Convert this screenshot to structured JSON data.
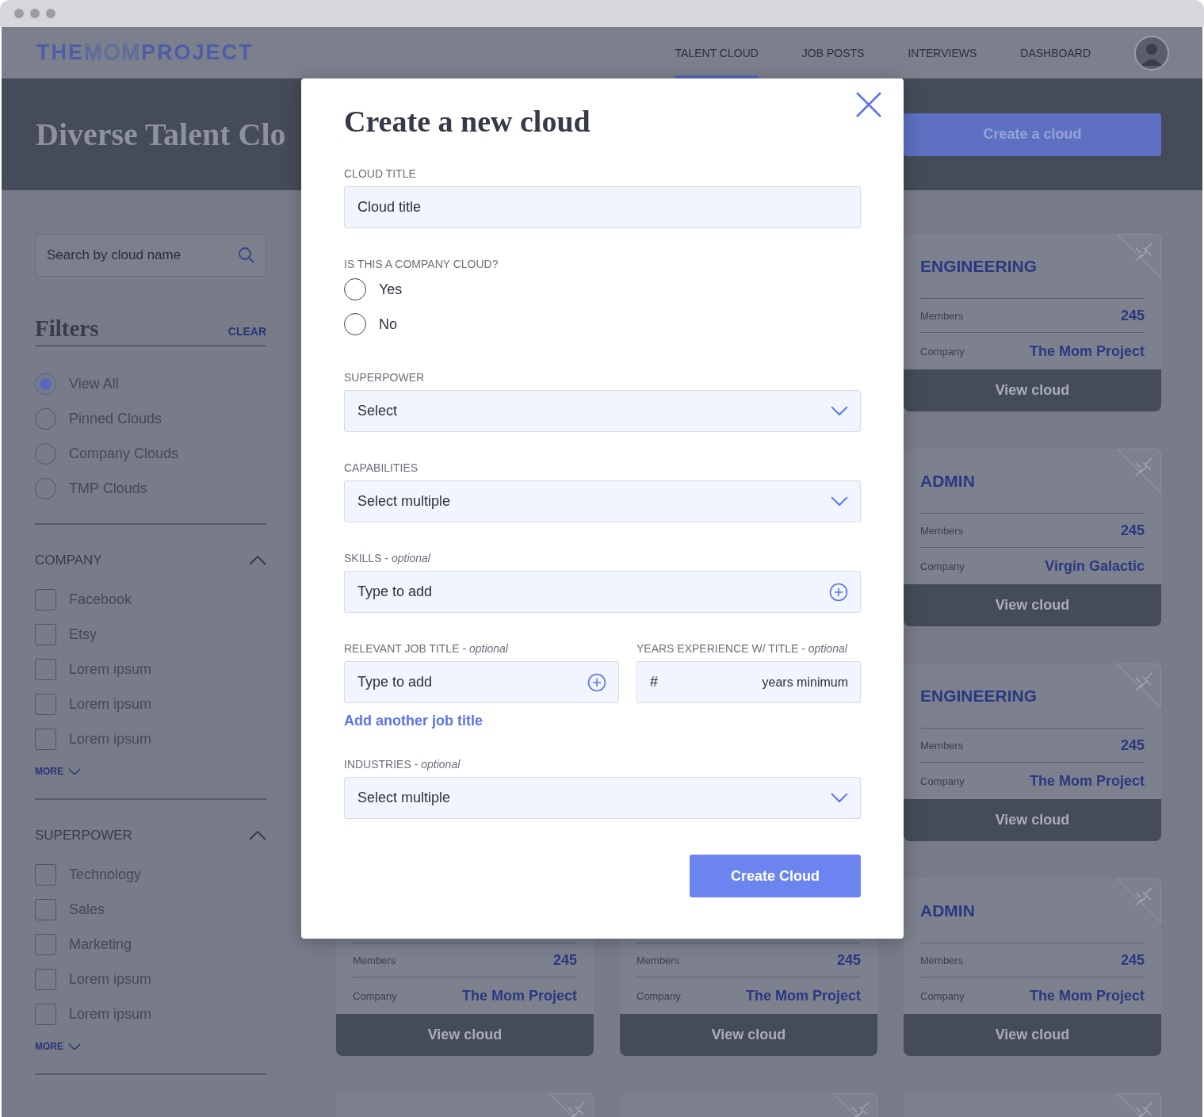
{
  "logo": [
    {
      "text": "THE",
      "kind": "solid"
    },
    {
      "text": "MOM",
      "kind": "outline"
    },
    {
      "text": "PROJECT",
      "kind": "solid"
    }
  ],
  "nav": [
    {
      "label": "TALENT CLOUD",
      "selected": true
    },
    {
      "label": "JOB POSTS",
      "selected": false
    },
    {
      "label": "INTERVIEWS",
      "selected": false
    },
    {
      "label": "DASHBOARD",
      "selected": false
    }
  ],
  "hero": {
    "title": "Diverse Talent Clo",
    "button": "Create a cloud"
  },
  "sidebar": {
    "search": {
      "placeholder": "Search by cloud name"
    },
    "filters_title": "Filters",
    "clear": "CLEAR",
    "views": [
      {
        "label": "View All",
        "selected": true
      },
      {
        "label": "Pinned Clouds",
        "selected": false
      },
      {
        "label": "Company Clouds",
        "selected": false
      },
      {
        "label": "TMP Clouds",
        "selected": false
      }
    ],
    "sections": [
      {
        "title": "COMPANY",
        "expanded": true,
        "more": "MORE",
        "options": [
          {
            "label": "Facebook",
            "checked": false
          },
          {
            "label": "Etsy",
            "checked": false
          },
          {
            "label": "Lorem ipsum",
            "checked": false
          },
          {
            "label": "Lorem ipsum",
            "checked": false
          },
          {
            "label": "Lorem ipsum",
            "checked": false
          }
        ]
      },
      {
        "title": "SUPERPOWER",
        "expanded": true,
        "more": "MORE",
        "options": [
          {
            "label": "Technology",
            "checked": false
          },
          {
            "label": "Sales",
            "checked": false
          },
          {
            "label": "Marketing",
            "checked": false
          },
          {
            "label": "Lorem ipsum",
            "checked": false
          },
          {
            "label": "Lorem ipsum",
            "checked": false
          }
        ]
      }
    ]
  },
  "card_rows": [
    [
      {
        "title": "ENGINEERING",
        "pinned": false,
        "members_label": "Members",
        "members": "245",
        "company_label": "Company",
        "company": "The Mom Project",
        "button": "View cloud"
      }
    ],
    [
      {
        "title": "ADMIN",
        "pinned": false,
        "members_label": "Members",
        "members": "245",
        "company_label": "Company",
        "company": "Virgin Galactic",
        "button": "View cloud"
      }
    ],
    [
      {
        "title": "ENGINEERING",
        "pinned": false,
        "members_label": "Members",
        "members": "245",
        "company_label": "Company",
        "company": "The Mom Project",
        "button": "View cloud"
      }
    ],
    [
      {
        "members_label": "Members",
        "members": "245",
        "company_label": "Company",
        "company": "The Mom Project",
        "button": "View cloud"
      },
      {
        "members_label": "Members",
        "members": "245",
        "company_label": "Company",
        "company": "The Mom Project",
        "button": "View cloud"
      },
      {
        "title": "ADMIN",
        "pinned": false,
        "members_label": "Members",
        "members": "245",
        "company_label": "Company",
        "company": "The Mom Project",
        "button": "View cloud"
      }
    ],
    [
      {
        "pinned": false
      },
      {
        "pinned": false
      },
      {
        "pinned": false
      }
    ]
  ],
  "modal": {
    "title": "Create a new cloud",
    "fields": [
      {
        "kind": "text",
        "label": "CLOUD TITLE",
        "placeholder": "Cloud title"
      },
      {
        "kind": "radio",
        "label": "IS THIS A COMPANY CLOUD?",
        "options": [
          {
            "label": "Yes",
            "selected": false
          },
          {
            "label": "No",
            "selected": false
          }
        ]
      },
      {
        "kind": "select",
        "label": "SUPERPOWER",
        "placeholder": "Select"
      },
      {
        "kind": "select",
        "label": "CAPABILITIES",
        "placeholder": "Select multiple"
      },
      {
        "kind": "add",
        "label": "SKILLS - *optional*",
        "placeholder": "Type to add"
      },
      {
        "kind": "pair",
        "left": {
          "kind": "add",
          "label": "RELEVANT JOB TITLE - *optional*",
          "placeholder": "Type to add"
        },
        "right": {
          "kind": "years",
          "label": "YEARS EXPERIENCE W/ TITLE - *optional*",
          "placeholder": "#",
          "suffix": "years minimum"
        },
        "link": "Add another job title"
      },
      {
        "kind": "select",
        "label": "INDUSTRIES - *optional*",
        "placeholder": "Select multiple"
      }
    ],
    "submit": "Create Cloud"
  }
}
